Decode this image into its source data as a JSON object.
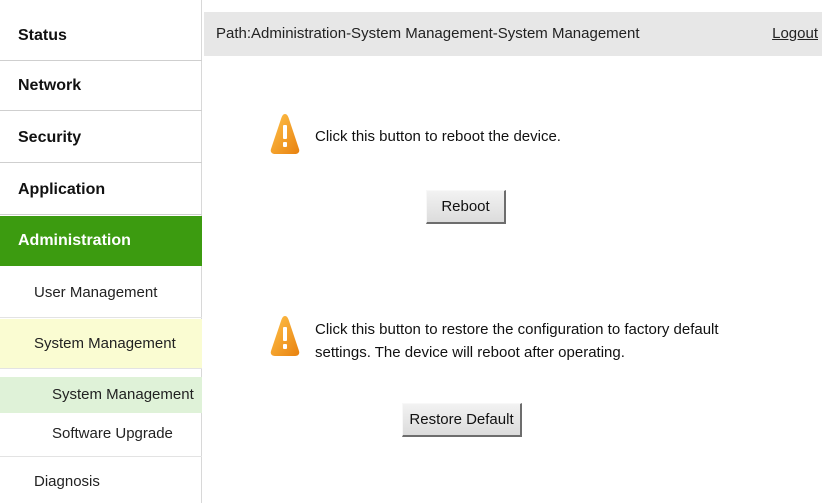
{
  "sidebar": {
    "top_items": [
      {
        "label": "Status"
      },
      {
        "label": "Network"
      },
      {
        "label": "Security"
      },
      {
        "label": "Application"
      },
      {
        "label": "Administration"
      }
    ],
    "sub_items": [
      {
        "label": "User Management"
      },
      {
        "label": "System Management"
      }
    ],
    "third_items": [
      {
        "label": "System Management"
      },
      {
        "label": "Software Upgrade"
      }
    ],
    "diagnosis_label": "Diagnosis"
  },
  "header": {
    "path": "Path:Administration-System Management-System Management",
    "logout_label": "Logout"
  },
  "main": {
    "reboot_message": "Click this button to reboot the device.",
    "reboot_button_label": "Reboot",
    "restore_message_line1": "Click this button to restore the configuration to factory default",
    "restore_message_line2": "settings. The device will reboot after operating.",
    "restore_button_label": "Restore Default"
  },
  "colors": {
    "active_nav_bg": "#3c9b10",
    "selected_sub_bg": "#fafcd2",
    "current_item_bg": "#dff2d8",
    "warning_icon": "#f39a1e",
    "header_bar_bg": "#e7e7e7"
  },
  "icons": {
    "warning": "warning-icon"
  }
}
